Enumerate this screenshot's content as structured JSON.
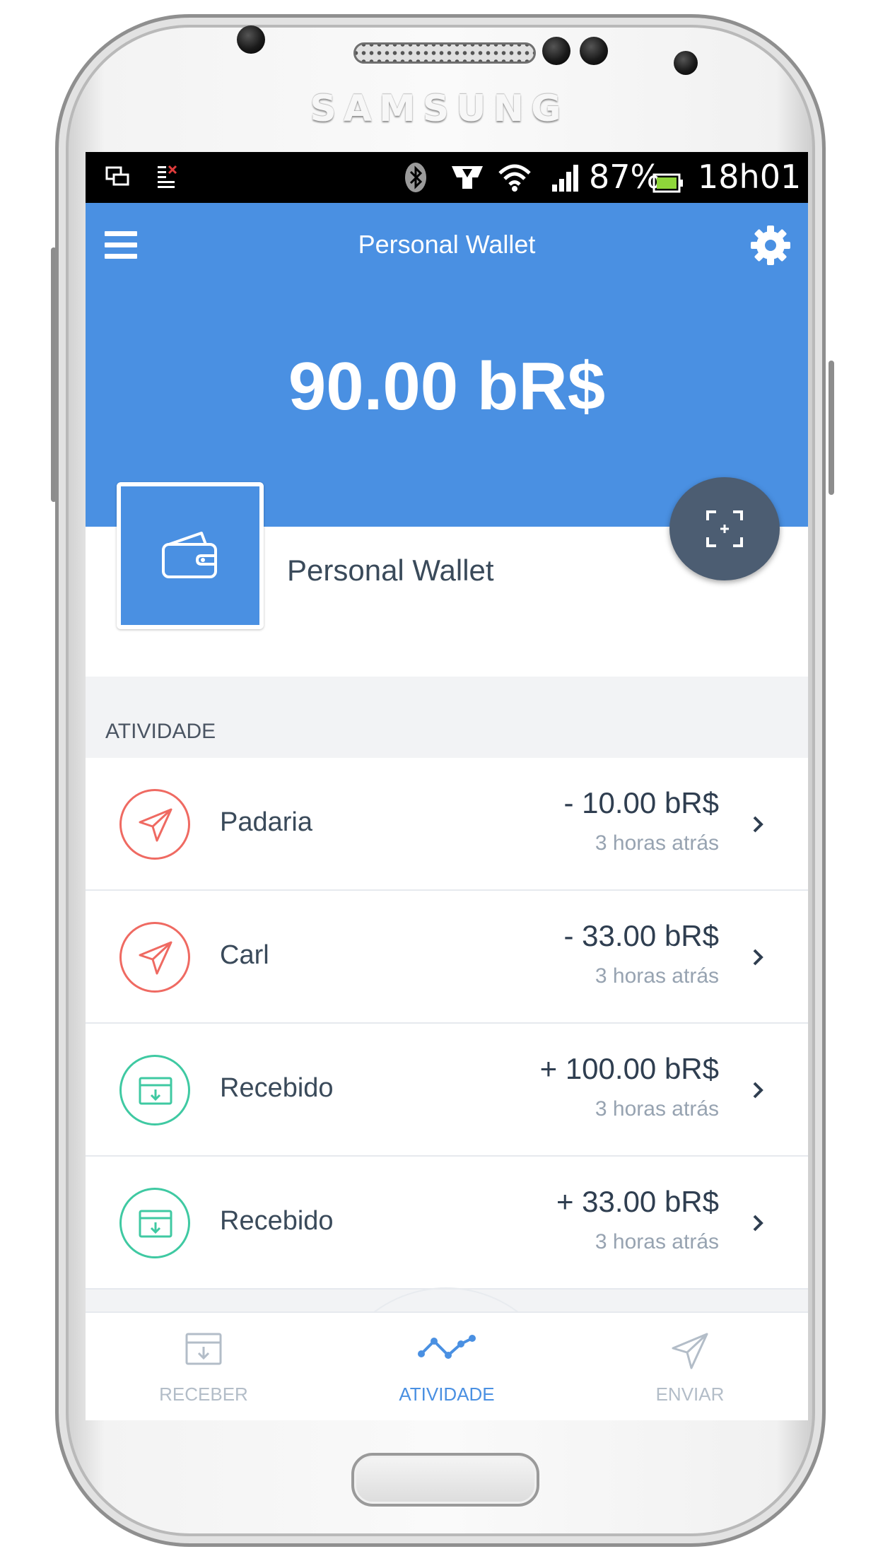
{
  "device": {
    "brand": "SAMSUNG"
  },
  "status_bar": {
    "battery": "87%",
    "time": "18h01"
  },
  "header": {
    "title": "Personal Wallet",
    "balance": "90.00 bR$",
    "menu_icon": "hamburger-menu-icon",
    "settings_icon": "gear-icon",
    "color": "#4a90e2"
  },
  "wallet": {
    "name": "Personal Wallet",
    "icon": "wallet-icon",
    "scan_icon": "scan-icon"
  },
  "activity": {
    "section_label": "ATIVIDADE",
    "items": [
      {
        "name": "Padaria",
        "amount": "- 10.00 bR$",
        "time": "3 horas atrás",
        "type": "sent"
      },
      {
        "name": "Carl",
        "amount": "- 33.00 bR$",
        "time": "3 horas atrás",
        "type": "sent"
      },
      {
        "name": "Recebido",
        "amount": "+ 100.00 bR$",
        "time": "3 horas atrás",
        "type": "received"
      },
      {
        "name": "Recebido",
        "amount": "+ 33.00 bR$",
        "time": "3 horas atrás",
        "type": "received"
      }
    ]
  },
  "bottom_nav": {
    "items": [
      {
        "label": "RECEBER",
        "icon": "receive-inbox-icon",
        "active": false
      },
      {
        "label": "ATIVIDADE",
        "icon": "activity-graph-icon",
        "active": true
      },
      {
        "label": "ENVIAR",
        "icon": "send-paper-plane-icon",
        "active": false
      }
    ]
  },
  "colors": {
    "sent": "#ef6a62",
    "received": "#3fc9a2",
    "fab": "#4c5d72"
  }
}
